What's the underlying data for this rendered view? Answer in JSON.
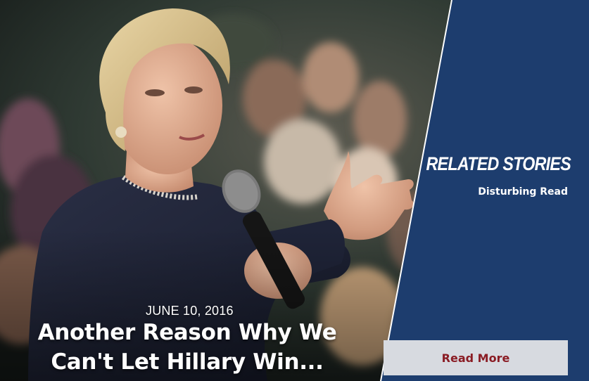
{
  "article": {
    "date": "JUNE 10, 2016",
    "headline": "Another Reason Why We Can't Let Hillary Win..."
  },
  "related": {
    "title": "RELATED STORIES",
    "items": [
      {
        "label": "Disturbing Read"
      }
    ],
    "read_more_label": "Read More"
  },
  "colors": {
    "panel": "#1d3d6e",
    "panel_edge": "#ffffff",
    "button_bg": "#d7dae0",
    "button_text": "#8a1c24"
  }
}
